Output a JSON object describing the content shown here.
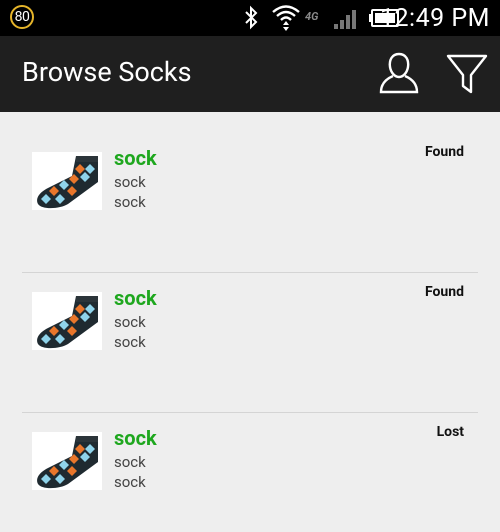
{
  "status_bar": {
    "notification_count": "80",
    "network_label": "4G",
    "time": "12:49 PM",
    "icons": [
      "bluetooth-icon",
      "wifi-icon",
      "signal-icon",
      "battery-icon"
    ]
  },
  "action_bar": {
    "title": "Browse Socks",
    "profile_icon": "person-outline-icon",
    "filter_icon": "funnel-filter-icon"
  },
  "items": [
    {
      "title": "sock",
      "line1": "sock",
      "line2": "sock",
      "status": "Found"
    },
    {
      "title": "sock",
      "line1": "sock",
      "line2": "sock",
      "status": "Found"
    },
    {
      "title": "sock",
      "line1": "sock",
      "line2": "sock",
      "status": "Lost"
    }
  ],
  "colors": {
    "accent": "#1ea71e",
    "action_bar": "#1f1f1f",
    "background": "#eeeeee",
    "badge_ring": "#e6b52a"
  }
}
